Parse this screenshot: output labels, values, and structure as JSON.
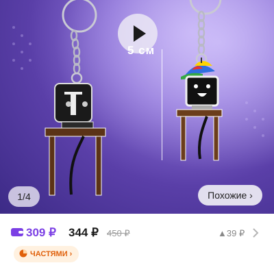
{
  "gallery": {
    "dimension_label": "5 см",
    "counter_current": "1",
    "counter_total": "4",
    "similar_label": "Похожие ›",
    "play_icon": "play-icon"
  },
  "price": {
    "wallet_price": "309 ₽",
    "price": "344 ₽",
    "old_price": "450 ₽",
    "price_diff": "▲39 ₽"
  },
  "installments": {
    "label": "ЧАСТЯМИ"
  },
  "colors": {
    "wallet_purple": "#7b3fe4",
    "installment_orange": "#e0610c"
  }
}
